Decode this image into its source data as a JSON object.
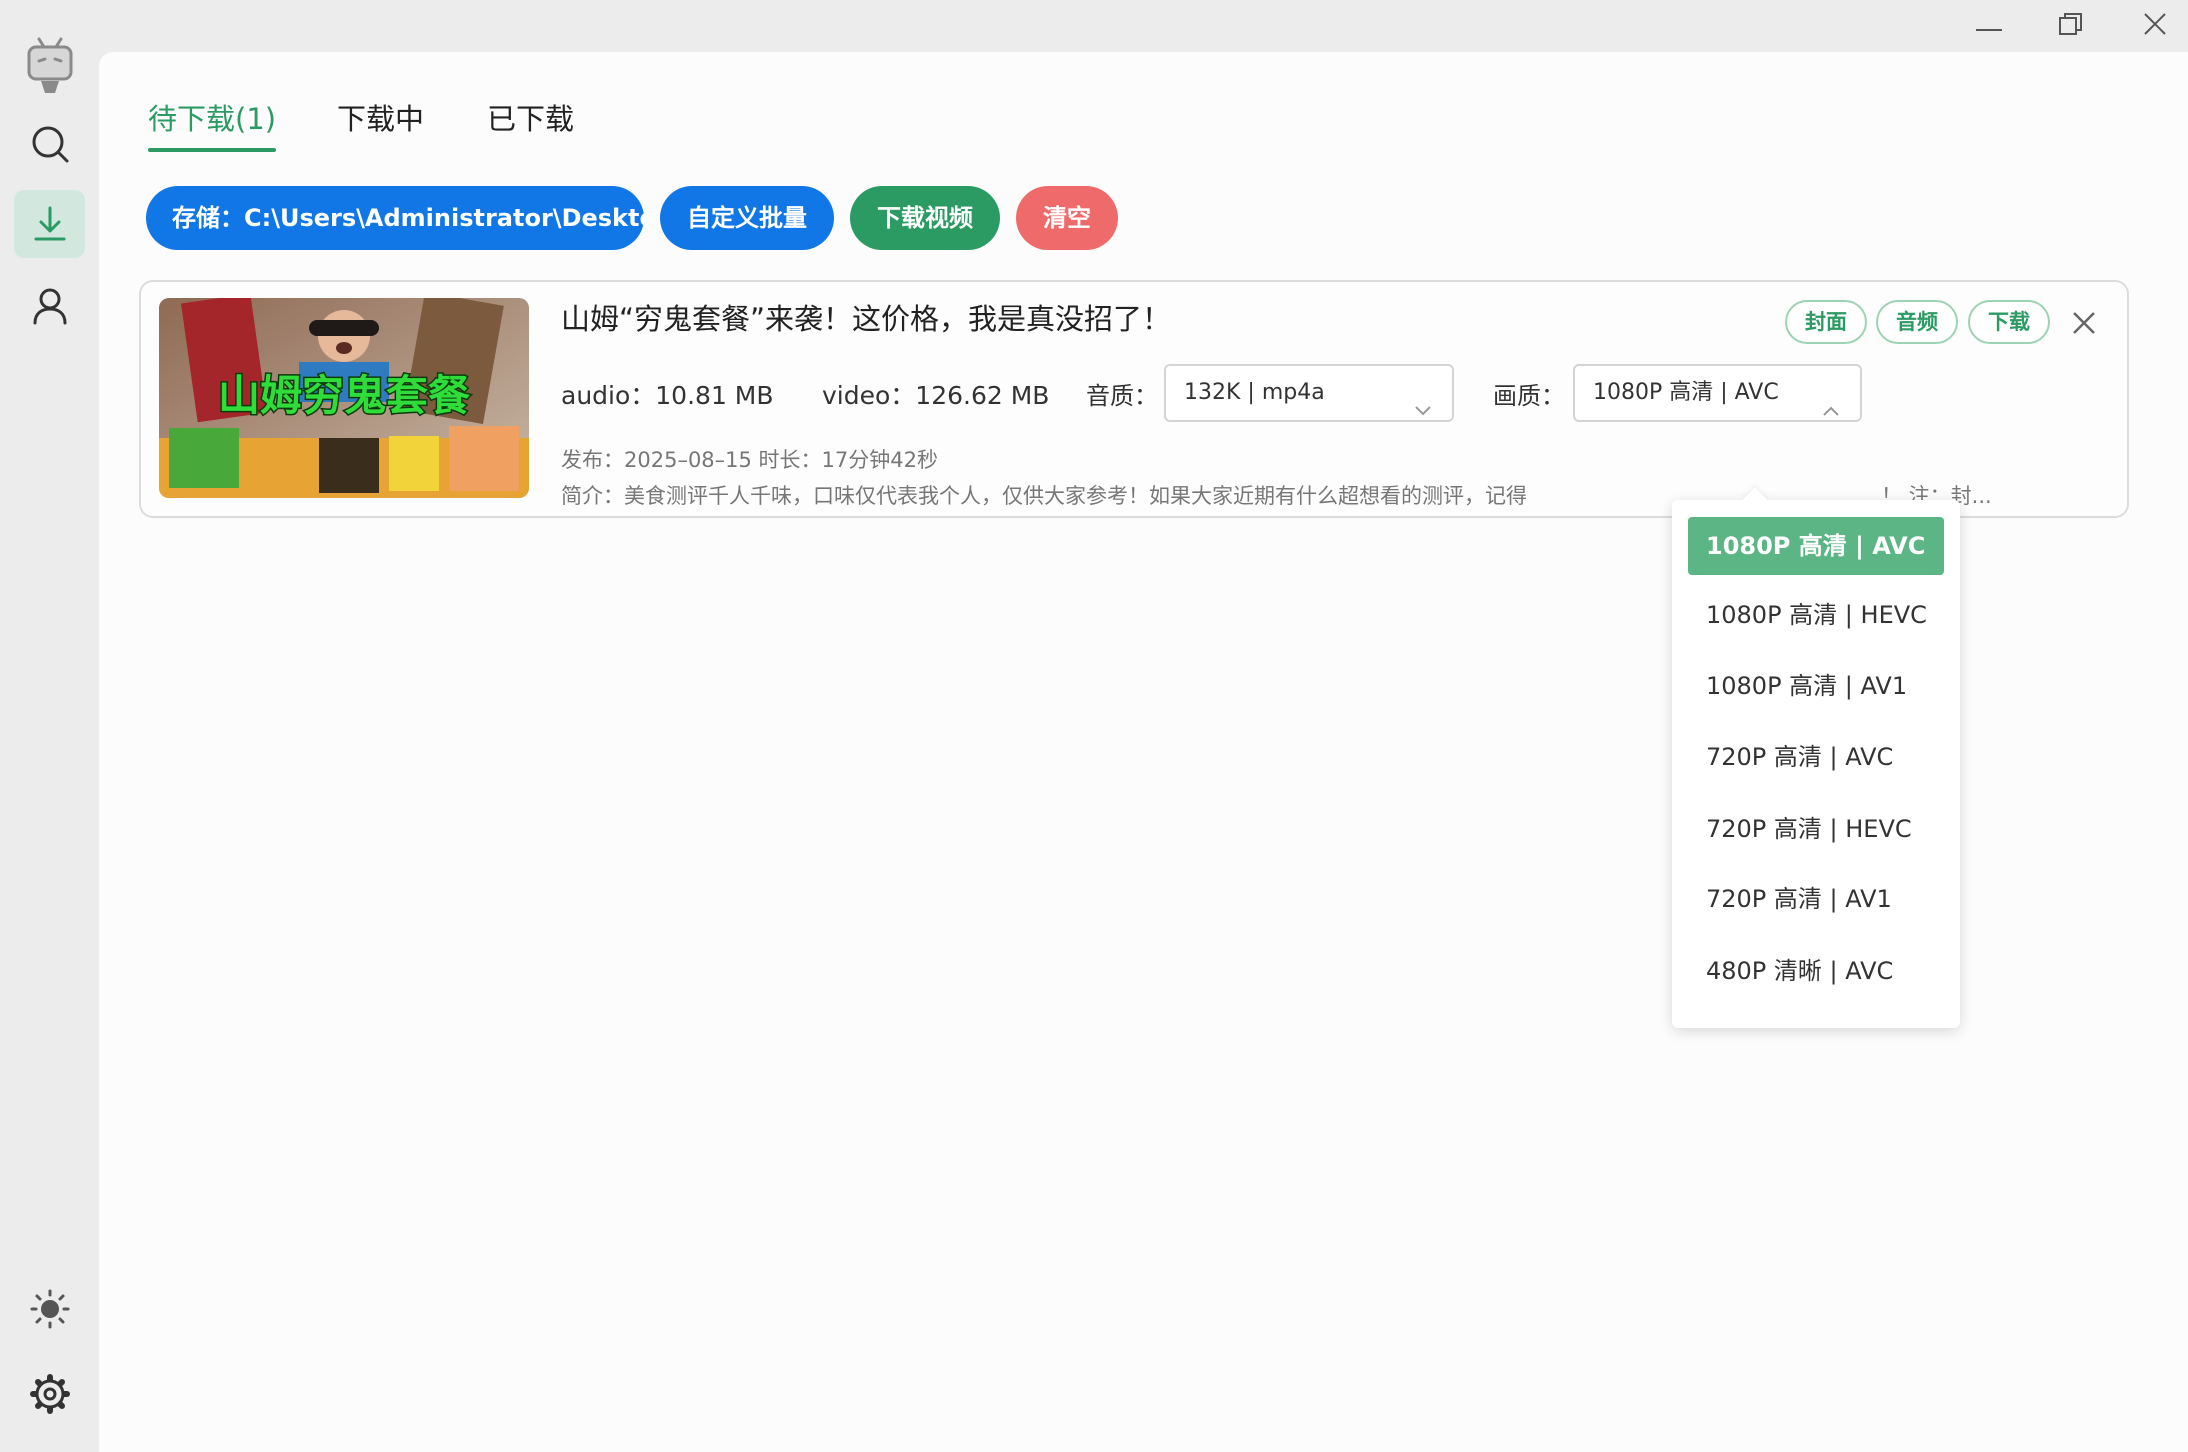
{
  "sidebar": {
    "items": [
      {
        "icon": "bilibili-tv-icon"
      },
      {
        "icon": "search-icon"
      },
      {
        "icon": "download-icon",
        "active": true
      },
      {
        "icon": "user-icon"
      }
    ],
    "bottom": [
      {
        "icon": "sun-icon"
      },
      {
        "icon": "gear-icon"
      }
    ]
  },
  "tabs": [
    {
      "label": "待下载(1)",
      "active": true
    },
    {
      "label": "下载中"
    },
    {
      "label": "已下载"
    }
  ],
  "toolbar": {
    "storage_label": "存储：C:\\Users\\Administrator\\Desktop",
    "batch_label": "自定义批量",
    "download_label": "下载视频",
    "clear_label": "清空"
  },
  "video": {
    "thumbnail_text": "山姆穷鬼套餐",
    "title": "山姆“穷鬼套餐”来袭！这价格，我是真没招了！",
    "audio_size": "audio：10.81 MB",
    "video_size": "video：126.62 MB",
    "audio_quality_label": "音质：",
    "audio_quality_value": "132K | mp4a",
    "video_quality_label": "画质：",
    "video_quality_value": "1080P 高清 | AVC",
    "publish_info": "发布：2025–08–15 时长：17分钟42秒",
    "description": "简介：美食测评千人千味，口味仅代表我个人，仅供大家参考！如果大家近期有什么超想看的测评，记得",
    "description_tail": "！ 注：封...",
    "actions": {
      "cover": "封面",
      "audio": "音频",
      "download": "下载"
    }
  },
  "quality_options": [
    {
      "label": "1080P 高清 | AVC",
      "selected": true
    },
    {
      "label": "1080P 高清 | HEVC"
    },
    {
      "label": "1080P 高清 | AV1"
    },
    {
      "label": "720P 高清 | AVC"
    },
    {
      "label": "720P 高清 | HEVC"
    },
    {
      "label": "720P 高清 | AV1"
    },
    {
      "label": "480P 清晰 | AVC"
    }
  ],
  "colors": {
    "accent_green": "#2c9b63",
    "primary_blue": "#1176e6",
    "danger_red": "#ef6a6a"
  }
}
